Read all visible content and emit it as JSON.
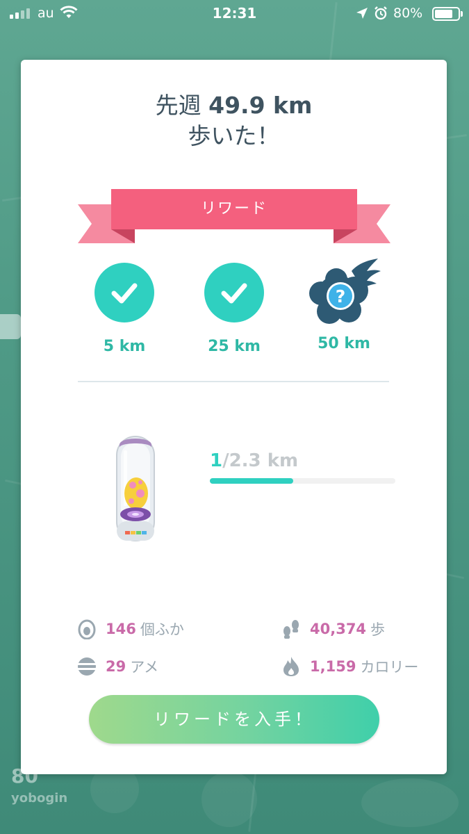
{
  "status_bar": {
    "carrier": "au",
    "time": "12:31",
    "battery_percent": "80%",
    "battery_level": 0.8,
    "icons": [
      "signal-icon",
      "wifi-icon",
      "location-arrow-icon",
      "alarm-icon",
      "battery-icon"
    ]
  },
  "background": {
    "level": "80",
    "trainer_name": "yobogin"
  },
  "dialog": {
    "title_prefix": "先週",
    "distance": "49.9 km",
    "title_suffix": "歩いた！",
    "ribbon_label": "リワード",
    "milestones": [
      {
        "label": "5 km",
        "state": "completed",
        "icon": "check-icon"
      },
      {
        "label": "25 km",
        "state": "completed",
        "icon": "check-icon"
      },
      {
        "label": "50 km",
        "state": "locked",
        "icon": "mystery-reward-icon"
      }
    ],
    "incubator": {
      "current": "1",
      "total": "/2.3 km",
      "progress": 0.45
    },
    "stats": {
      "eggs_hatched": {
        "value": "146",
        "unit": "個ふか",
        "icon": "egg-icon"
      },
      "steps": {
        "value": "40,374",
        "unit": "歩",
        "icon": "footprints-icon"
      },
      "candy": {
        "value": "29",
        "unit": "アメ",
        "icon": "candy-icon"
      },
      "calories": {
        "value": "1,159",
        "unit": "カロリー",
        "icon": "flame-icon"
      }
    },
    "button_label": "リワードを入手！"
  },
  "colors": {
    "accent_teal": "#2fd0c0",
    "ribbon_pink": "#f4607e",
    "stat_pink": "#c96aa8",
    "title_gray": "#3f5360"
  }
}
